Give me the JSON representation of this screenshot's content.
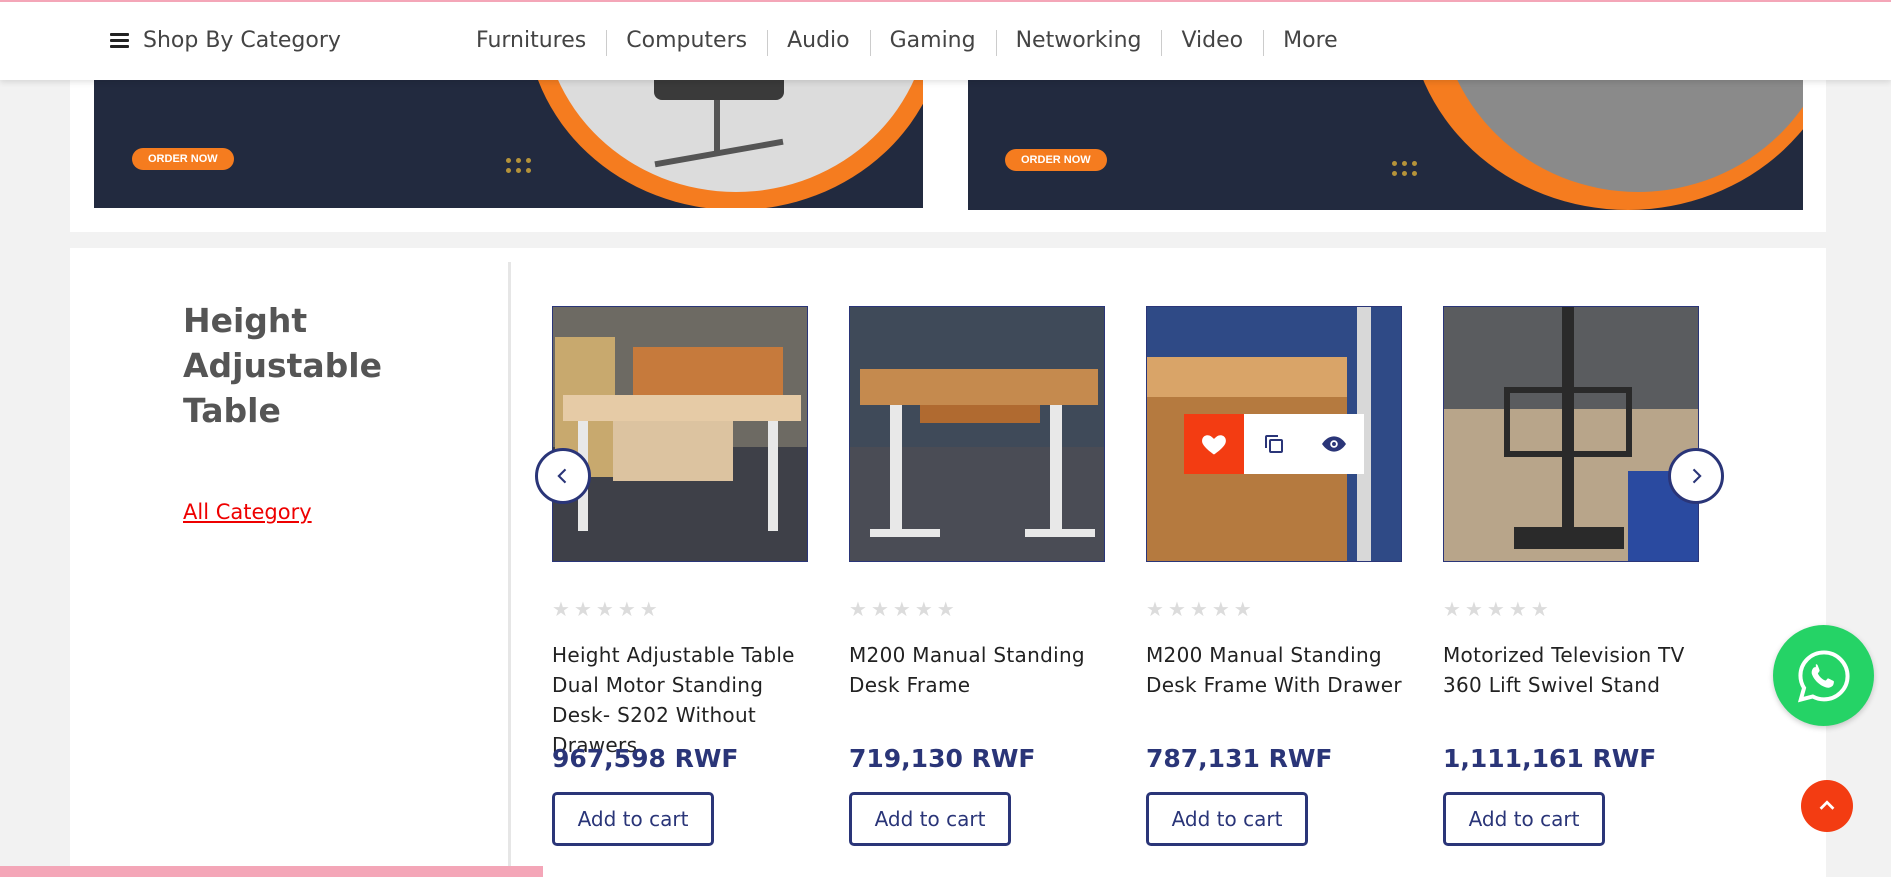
{
  "nav": {
    "shop_by_category": "Shop By Category",
    "links": [
      "Furnitures",
      "Computers",
      "Audio",
      "Gaming",
      "Networking",
      "Video",
      "More"
    ]
  },
  "banners": [
    {
      "button": "ORDER NOW"
    },
    {
      "button": "ORDER NOW"
    }
  ],
  "section": {
    "title": "Height Adjustable Table",
    "all_category": "All Category"
  },
  "products": [
    {
      "name": "Height Adjustable Table Dual Motor Standing Desk- S202 Without Drawers",
      "price": "967,598 RWF",
      "rating": 0,
      "add_to_cart": "Add to cart"
    },
    {
      "name": "M200 Manual Standing Desk Frame",
      "price": "719,130 RWF",
      "rating": 0,
      "add_to_cart": "Add to cart"
    },
    {
      "name": "M200 Manual Standing Desk Frame With Drawer",
      "price": "787,131 RWF",
      "rating": 0,
      "add_to_cart": "Add to cart"
    },
    {
      "name": "Motorized Television TV 360 Lift Swivel Stand",
      "price": "1,111,161 RWF",
      "rating": 0,
      "add_to_cart": "Add to cart"
    }
  ],
  "colors": {
    "accent": "#2a3578",
    "orange": "#f57c1f",
    "red": "#f33c12",
    "whatsapp": "#25d366",
    "link": "#e00000"
  },
  "icons": {
    "menu": "hamburger-icon",
    "wishlist": "heart-icon",
    "compare": "copy-icon",
    "quickview": "eye-icon",
    "prev": "chevron-left-icon",
    "next": "chevron-right-icon",
    "whatsapp": "whatsapp-icon",
    "totop": "chevron-up-icon"
  }
}
